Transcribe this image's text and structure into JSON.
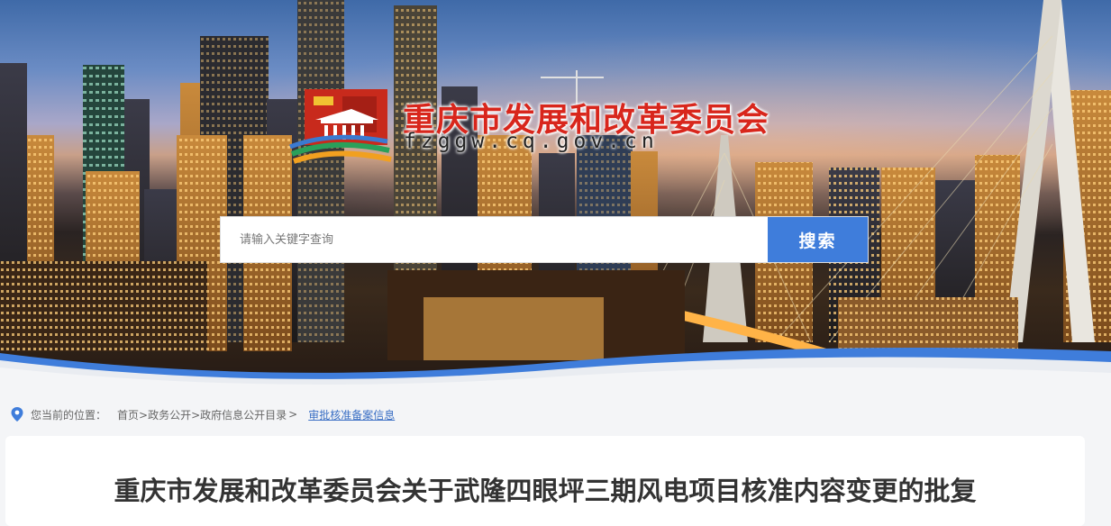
{
  "header": {
    "site_title": "重庆市发展和改革委员会",
    "site_domain": "fzggw.cq.gov.cn",
    "logo_icon": "government-building-logo-icon"
  },
  "search": {
    "placeholder": "请输入关键字查询",
    "value": "",
    "button_label": "搜索",
    "button_color": "#3f7ddb"
  },
  "breadcrumb": {
    "label": "您当前的位置：",
    "icon": "location-pin-icon",
    "items": [
      "首页",
      ">政务公开",
      ">政府信息公开目录",
      ">"
    ],
    "current": "审批核准备案信息",
    "current_color": "#3a6fc4"
  },
  "article": {
    "title": "重庆市发展和改革委员会关于武隆四眼坪三期风电项目核准内容变更的批复"
  }
}
